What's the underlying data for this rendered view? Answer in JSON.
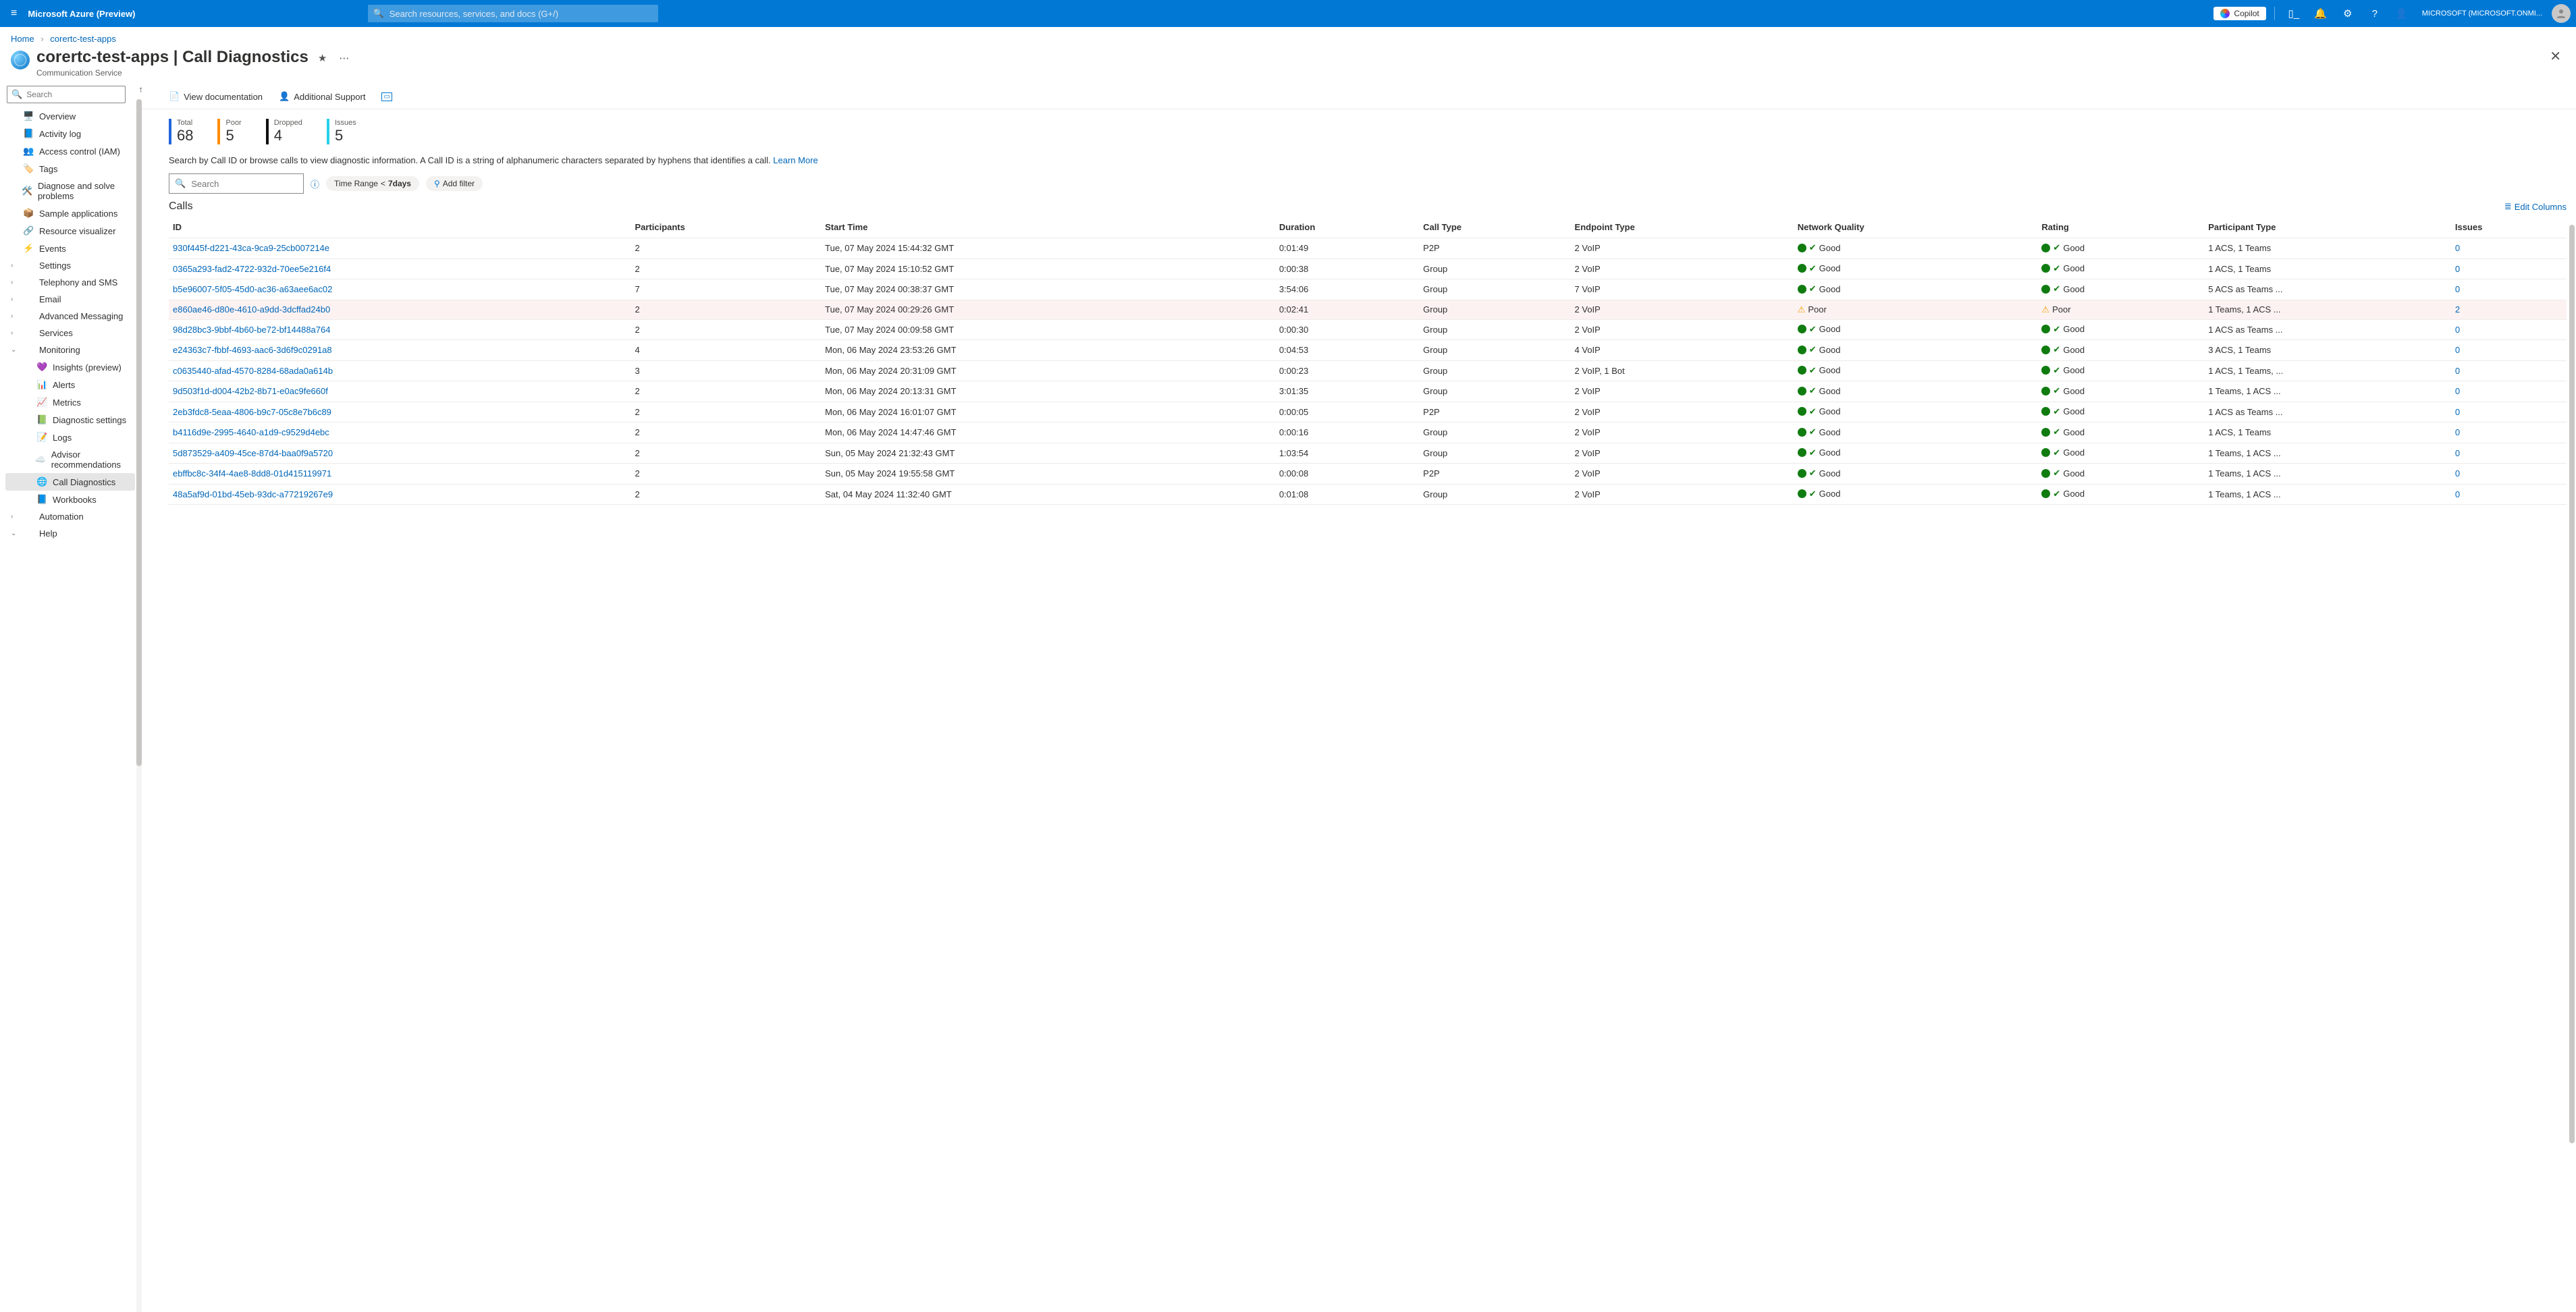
{
  "topbar": {
    "portal_title": "Microsoft Azure (Preview)",
    "search_placeholder": "Search resources, services, and docs (G+/)",
    "copilot_label": "Copilot",
    "account_label": "MICROSOFT (MICROSOFT.ONMI..."
  },
  "breadcrumb": {
    "items": [
      "Home",
      "corertc-test-apps"
    ]
  },
  "header": {
    "title_prefix": "corertc-test-apps",
    "title_suffix": " | Call Diagnostics",
    "subtitle": "Communication Service"
  },
  "sidebar": {
    "search_placeholder": "Search",
    "items": [
      {
        "icon": "🖥️",
        "label": "Overview",
        "chev": ""
      },
      {
        "icon": "📘",
        "label": "Activity log",
        "chev": ""
      },
      {
        "icon": "👥",
        "label": "Access control (IAM)",
        "chev": "",
        "icon_color": "#0078d4"
      },
      {
        "icon": "🏷️",
        "label": "Tags",
        "chev": "",
        "icon_color": "#8e5bd6"
      },
      {
        "icon": "🛠️",
        "label": "Diagnose and solve problems",
        "chev": ""
      },
      {
        "icon": "📦",
        "label": "Sample applications",
        "chev": ""
      },
      {
        "icon": "🔗",
        "label": "Resource visualizer",
        "chev": ""
      },
      {
        "icon": "⚡",
        "label": "Events",
        "chev": "",
        "icon_color": "#ffb900"
      },
      {
        "icon": "",
        "label": "Settings",
        "chev": "›"
      },
      {
        "icon": "",
        "label": "Telephony and SMS",
        "chev": "›"
      },
      {
        "icon": "",
        "label": "Email",
        "chev": "›"
      },
      {
        "icon": "",
        "label": "Advanced Messaging",
        "chev": "›"
      },
      {
        "icon": "",
        "label": "Services",
        "chev": "›"
      },
      {
        "icon": "",
        "label": "Monitoring",
        "chev": "⌄",
        "expanded": true
      },
      {
        "icon": "💜",
        "label": "Insights (preview)",
        "chev": "",
        "child": true
      },
      {
        "icon": "📊",
        "label": "Alerts",
        "chev": "",
        "child": true
      },
      {
        "icon": "📈",
        "label": "Metrics",
        "chev": "",
        "child": true
      },
      {
        "icon": "📗",
        "label": "Diagnostic settings",
        "chev": "",
        "child": true
      },
      {
        "icon": "📝",
        "label": "Logs",
        "chev": "",
        "child": true
      },
      {
        "icon": "☁️",
        "label": "Advisor recommendations",
        "chev": "",
        "child": true
      },
      {
        "icon": "🌐",
        "label": "Call Diagnostics",
        "chev": "",
        "child": true,
        "selected": true
      },
      {
        "icon": "📘",
        "label": "Workbooks",
        "chev": "",
        "child": true
      },
      {
        "icon": "",
        "label": "Automation",
        "chev": "›"
      },
      {
        "icon": "",
        "label": "Help",
        "chev": "⌄"
      }
    ]
  },
  "toolbar": {
    "view_docs": "View documentation",
    "support": "Additional Support"
  },
  "stats": {
    "total": {
      "label": "Total",
      "value": "68"
    },
    "poor": {
      "label": "Poor",
      "value": "5"
    },
    "dropped": {
      "label": "Dropped",
      "value": "4"
    },
    "issues": {
      "label": "Issues",
      "value": "5"
    }
  },
  "help": {
    "text": "Search by Call ID or browse calls to view diagnostic information. A Call ID is a string of alphanumeric characters separated by hyphens that identifies a call. ",
    "learn_more": "Learn More"
  },
  "filters": {
    "search_placeholder": "Search",
    "time_range_label": "Time Range",
    "time_range_value": "7days",
    "add_filter_label": "Add filter"
  },
  "table": {
    "heading": "Calls",
    "edit_cols": "Edit Columns",
    "columns": [
      "ID",
      "Participants",
      "Start Time",
      "Duration",
      "Call Type",
      "Endpoint Type",
      "Network Quality",
      "Rating",
      "Participant Type",
      "Issues"
    ],
    "rows": [
      {
        "id": "930f445f-d221-43ca-9ca9-25cb007214e",
        "p": "2",
        "start": "Tue, 07 May 2024 15:44:32 GMT",
        "dur": "0:01:49",
        "ctype": "P2P",
        "etype": "2 VoIP",
        "net": "Good",
        "rating": "Good",
        "ptype": "1 ACS, 1 Teams",
        "issues": "0"
      },
      {
        "id": "0365a293-fad2-4722-932d-70ee5e216f4",
        "p": "2",
        "start": "Tue, 07 May 2024 15:10:52 GMT",
        "dur": "0:00:38",
        "ctype": "Group",
        "etype": "2 VoIP",
        "net": "Good",
        "rating": "Good",
        "ptype": "1 ACS, 1 Teams",
        "issues": "0"
      },
      {
        "id": "b5e96007-5f05-45d0-ac36-a63aee6ac02",
        "p": "7",
        "start": "Tue, 07 May 2024 00:38:37 GMT",
        "dur": "3:54:06",
        "ctype": "Group",
        "etype": "7 VoIP",
        "net": "Good",
        "rating": "Good",
        "ptype": "5 ACS as Teams ...",
        "issues": "0"
      },
      {
        "id": "e860ae46-d80e-4610-a9dd-3dcffad24b0",
        "p": "2",
        "start": "Tue, 07 May 2024 00:29:26 GMT",
        "dur": "0:02:41",
        "ctype": "Group",
        "etype": "2 VoIP",
        "net": "Poor",
        "rating": "Poor",
        "ptype": "1 Teams, 1 ACS ...",
        "issues": "2",
        "warn": true
      },
      {
        "id": "98d28bc3-9bbf-4b60-be72-bf14488a764",
        "p": "2",
        "start": "Tue, 07 May 2024 00:09:58 GMT",
        "dur": "0:00:30",
        "ctype": "Group",
        "etype": "2 VoIP",
        "net": "Good",
        "rating": "Good",
        "ptype": "1 ACS as Teams ...",
        "issues": "0"
      },
      {
        "id": "e24363c7-fbbf-4693-aac6-3d6f9c0291a8",
        "p": "4",
        "start": "Mon, 06 May 2024 23:53:26 GMT",
        "dur": "0:04:53",
        "ctype": "Group",
        "etype": "4 VoIP",
        "net": "Good",
        "rating": "Good",
        "ptype": "3 ACS, 1 Teams",
        "issues": "0"
      },
      {
        "id": "c0635440-afad-4570-8284-68ada0a614b",
        "p": "3",
        "start": "Mon, 06 May 2024 20:31:09 GMT",
        "dur": "0:00:23",
        "ctype": "Group",
        "etype": "2 VoIP, 1 Bot",
        "net": "Good",
        "rating": "Good",
        "ptype": "1 ACS, 1 Teams, ...",
        "issues": "0"
      },
      {
        "id": "9d503f1d-d004-42b2-8b71-e0ac9fe660f",
        "p": "2",
        "start": "Mon, 06 May 2024 20:13:31 GMT",
        "dur": "3:01:35",
        "ctype": "Group",
        "etype": "2 VoIP",
        "net": "Good",
        "rating": "Good",
        "ptype": "1 Teams, 1 ACS ...",
        "issues": "0"
      },
      {
        "id": "2eb3fdc8-5eaa-4806-b9c7-05c8e7b6c89",
        "p": "2",
        "start": "Mon, 06 May 2024 16:01:07 GMT",
        "dur": "0:00:05",
        "ctype": "P2P",
        "etype": "2 VoIP",
        "net": "Good",
        "rating": "Good",
        "ptype": "1 ACS as Teams ...",
        "issues": "0"
      },
      {
        "id": "b4116d9e-2995-4640-a1d9-c9529d4ebc",
        "p": "2",
        "start": "Mon, 06 May 2024 14:47:46 GMT",
        "dur": "0:00:16",
        "ctype": "Group",
        "etype": "2 VoIP",
        "net": "Good",
        "rating": "Good",
        "ptype": "1 ACS, 1 Teams",
        "issues": "0"
      },
      {
        "id": "5d873529-a409-45ce-87d4-baa0f9a5720",
        "p": "2",
        "start": "Sun, 05 May 2024 21:32:43 GMT",
        "dur": "1:03:54",
        "ctype": "Group",
        "etype": "2 VoIP",
        "net": "Good",
        "rating": "Good",
        "ptype": "1 Teams, 1 ACS ...",
        "issues": "0"
      },
      {
        "id": "ebffbc8c-34f4-4ae8-8dd8-01d415119971",
        "p": "2",
        "start": "Sun, 05 May 2024 19:55:58 GMT",
        "dur": "0:00:08",
        "ctype": "P2P",
        "etype": "2 VoIP",
        "net": "Good",
        "rating": "Good",
        "ptype": "1 Teams, 1 ACS ...",
        "issues": "0"
      },
      {
        "id": "48a5af9d-01bd-45eb-93dc-a77219267e9",
        "p": "2",
        "start": "Sat, 04 May 2024 11:32:40 GMT",
        "dur": "0:01:08",
        "ctype": "Group",
        "etype": "2 VoIP",
        "net": "Good",
        "rating": "Good",
        "ptype": "1 Teams, 1 ACS ...",
        "issues": "0"
      }
    ]
  }
}
